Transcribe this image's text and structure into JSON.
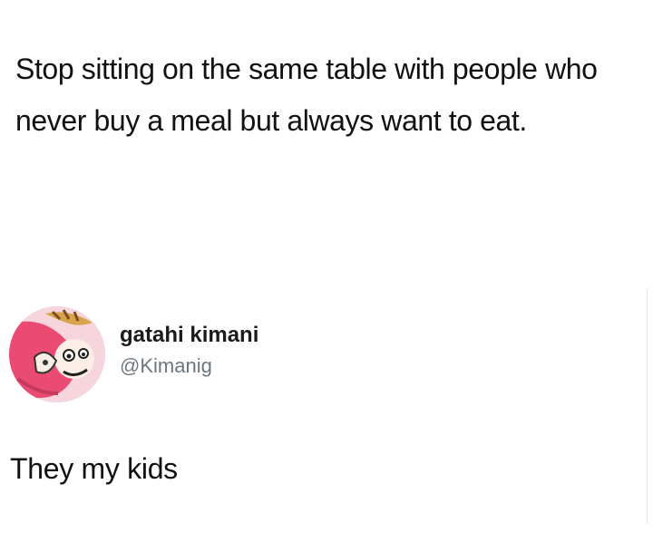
{
  "original_tweet": {
    "text": "Stop sitting on the same table with people who never buy a meal but always want to eat."
  },
  "reply": {
    "display_name": "gatahi kimani",
    "handle": "@Kimanig",
    "text": "They my kids",
    "avatar_icon": "cartoon-avatar-icon"
  },
  "colors": {
    "text": "#111111",
    "handle": "#6e767d",
    "background": "#ffffff"
  }
}
